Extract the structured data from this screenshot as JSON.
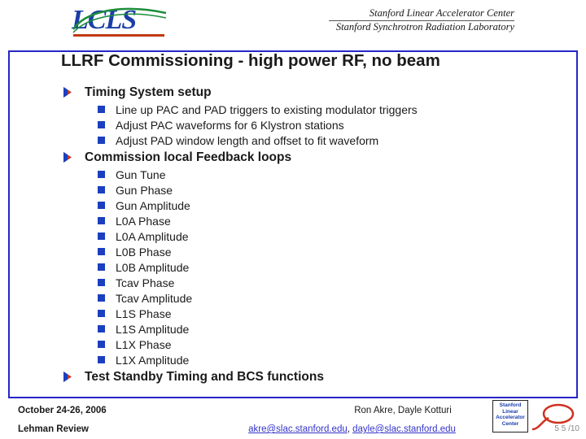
{
  "header": {
    "logo_left": "LCLS",
    "logo_left_name": "lcls-logo",
    "org_line1": "Stanford Linear Accelerator Center",
    "org_line2": "Stanford Synchrotron Radiation Laboratory"
  },
  "slide": {
    "title": "LLRF Commissioning - high power RF, no beam",
    "sections": [
      {
        "heading": "Timing System setup",
        "items": [
          "Line up PAC and PAD triggers to existing modulator triggers",
          "Adjust PAC waveforms for 6 Klystron stations",
          "Adjust PAD window length and offset to fit waveform"
        ]
      },
      {
        "heading": "Commission local Feedback loops",
        "items": [
          "Gun Tune",
          "Gun Phase",
          "Gun Amplitude",
          "L0A Phase",
          "L0A Amplitude",
          "L0B Phase",
          "L0B Amplitude",
          "Tcav Phase",
          "Tcav Amplitude",
          "L1S Phase",
          "L1S Amplitude",
          "L1X Phase",
          "L1X Amplitude"
        ]
      },
      {
        "heading": "Test Standby Timing and BCS functions",
        "items": []
      }
    ]
  },
  "footer": {
    "date": "October 24-26, 2006",
    "review": "Lehman Review",
    "authors": "Ron Akre, Dayle Kotturi",
    "email1": "akre@slac.stanford.edu",
    "email_separator": ", ",
    "email2": "dayle@slac.stanford.edu",
    "page_number": "5 5 /10",
    "badge_line1": "Stanford",
    "badge_line2": "Linear",
    "badge_line3": "Accelerator",
    "badge_line4": "Center"
  },
  "colors": {
    "border_blue": "#2626c8",
    "bullet_blue": "#1b3fbf",
    "link_blue": "#3333cc",
    "logo_blue": "#1a3ea8",
    "logo_red": "#c03a10"
  }
}
